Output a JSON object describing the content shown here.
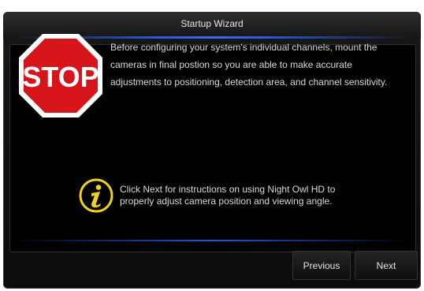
{
  "window": {
    "title": "Startup Wizard"
  },
  "stop_sign": {
    "label": "STOP",
    "icon": "stop-sign-icon",
    "colors": {
      "fill": "#d7141a",
      "border": "#ffffff"
    }
  },
  "message": "Before configuring your system's individual channels, mount the cameras in final postion so you are able to make accurate adjustments to positioning, detection area, and channel sensitivity.",
  "note": {
    "icon": "info-icon",
    "text": "Click Next for instructions on using Night Owl HD to properly adjust camera position and viewing angle.",
    "icon_color": "#f3d21b"
  },
  "buttons": {
    "previous": "Previous",
    "next": "Next"
  },
  "colors": {
    "accent_blue": "#2a56d8",
    "background": "#000000"
  }
}
